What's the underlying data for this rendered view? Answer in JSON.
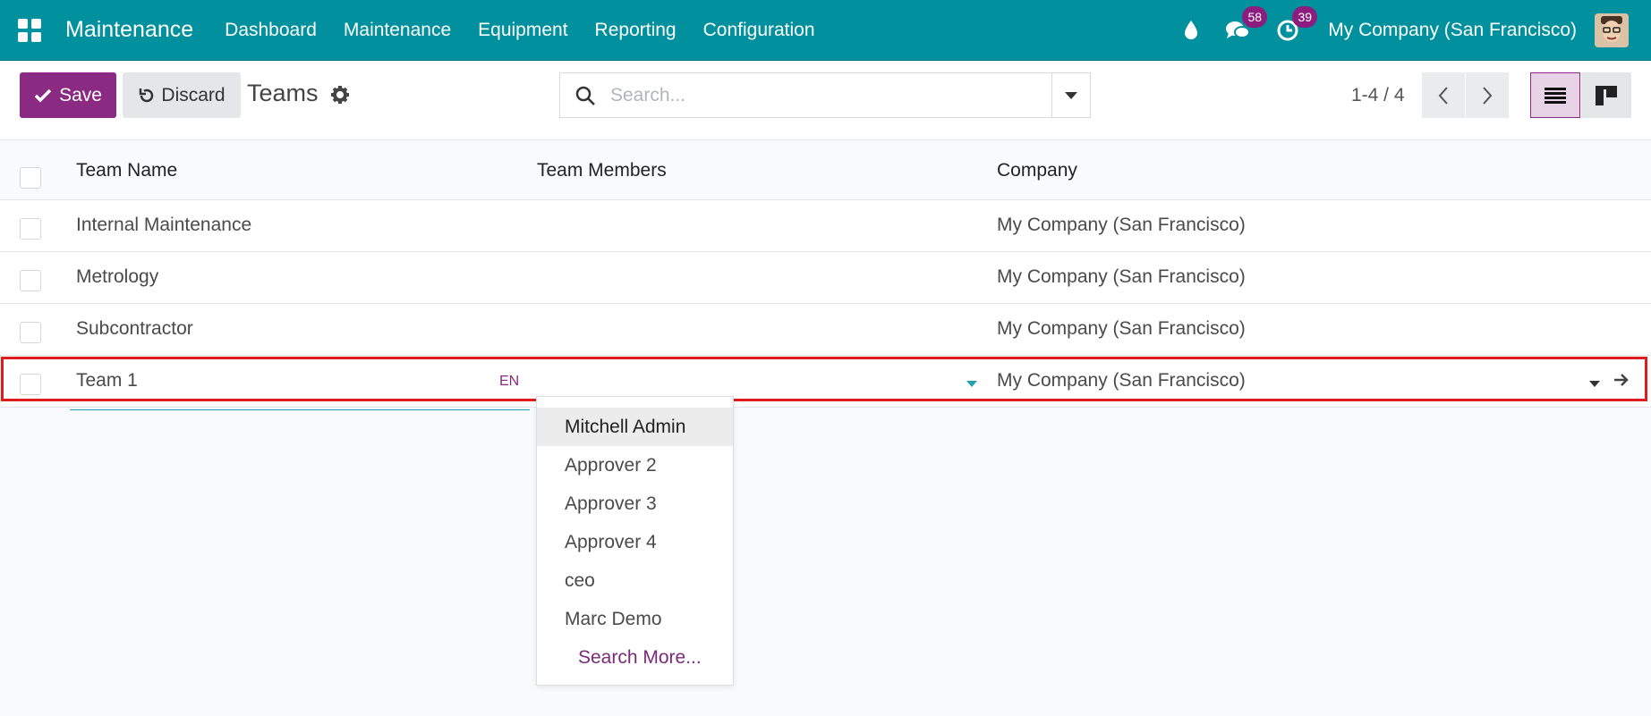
{
  "navbar": {
    "brand": "Maintenance",
    "menu": [
      "Dashboard",
      "Maintenance",
      "Equipment",
      "Reporting",
      "Configuration"
    ],
    "messages_count": "58",
    "activities_count": "39",
    "company": "My Company (San Francisco)"
  },
  "control_panel": {
    "save_label": "Save",
    "discard_label": "Discard",
    "title": "Teams",
    "search_placeholder": "Search...",
    "pager": "1-4 / 4"
  },
  "list": {
    "columns": [
      "Team Name",
      "Team Members",
      "Company"
    ],
    "rows": [
      {
        "name": "Internal Maintenance",
        "members": "",
        "company": "My Company (San Francisco)"
      },
      {
        "name": "Metrology",
        "members": "",
        "company": "My Company (San Francisco)"
      },
      {
        "name": "Subcontractor",
        "members": "",
        "company": "My Company (San Francisco)"
      },
      {
        "name": "Team 1",
        "members": "",
        "company": "My Company (San Francisco)"
      }
    ],
    "lang_tag": "EN"
  },
  "dropdown": {
    "items": [
      "Mitchell Admin",
      "Approver 2",
      "Approver 3",
      "Approver 4",
      "ceo",
      "Marc Demo"
    ],
    "search_more": "Search More..."
  },
  "colors": {
    "navbar": "#00909e",
    "primary": "#8a2a82",
    "badge": "#8c1d7e",
    "highlight_outline": "#e01b1b"
  }
}
